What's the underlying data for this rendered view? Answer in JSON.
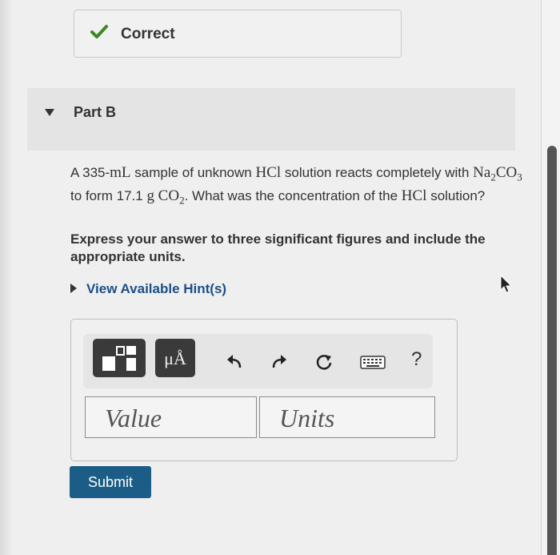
{
  "feedback": {
    "status_label": "Correct",
    "status_icon": "checkmark-icon",
    "status_color": "#3a8a24"
  },
  "part": {
    "title": "Part B",
    "expand_icon": "caret-down-icon"
  },
  "question": {
    "text_1": "A 335-",
    "unit_ml": "mL",
    "text_2": " sample of unknown ",
    "hcl": "HCl",
    "text_3": " solution reacts completely with ",
    "na": "Na",
    "sub_2": "2",
    "co": "CO",
    "sub_3": "3",
    "text_4": " to form 17.1 ",
    "g": "g",
    "co2": "CO",
    "co2_sub": "2",
    "text_5": ". What was the concentration of the ",
    "hcl_2": "HCl",
    "text_6": " solution?"
  },
  "instructions": "Express your answer to three significant figures and include the appropriate units.",
  "hint": {
    "label": "View Available Hint(s)"
  },
  "toolbar": {
    "templates_icon": "templates-icon",
    "units_label": "μÅ",
    "undo_icon": "undo-icon",
    "redo_icon": "redo-icon",
    "reset_icon": "reset-icon",
    "keyboard_icon": "keyboard-icon",
    "help_label": "?"
  },
  "answer": {
    "value_placeholder": "Value",
    "units_placeholder": "Units"
  },
  "submit": {
    "label": "Submit",
    "color": "#1b5d86"
  }
}
